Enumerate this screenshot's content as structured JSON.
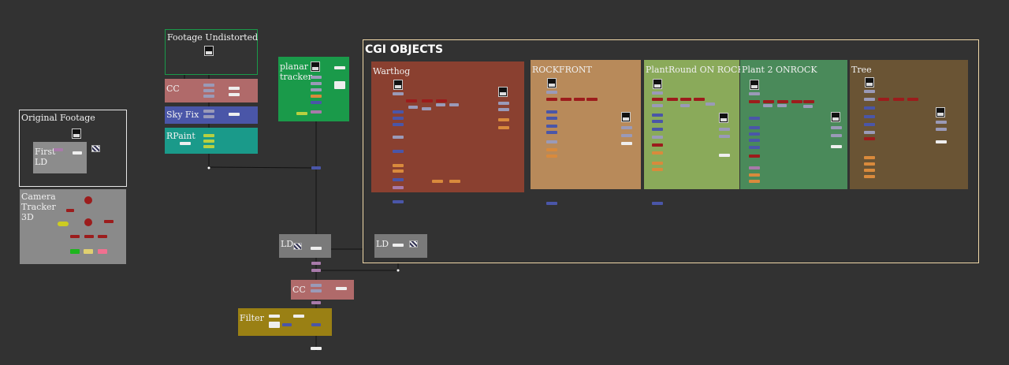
{
  "backdrops": {
    "original_footage": "Original Footage",
    "first_ld": "First\nLD",
    "camera_tracker": "Camera\nTracker\n3D",
    "footage_undistorted": "Footage Undistorted",
    "cc_top": "CC",
    "sky_fix": "Sky Fix",
    "rpaint": "RPaint",
    "planar_tracker": "planar\ntracker",
    "cgi_objects": "CGI OBJECTS",
    "warthog": "Warthog",
    "rockfront": "ROCKFRONT",
    "plantround": "PlantRound ON ROCK",
    "plant2": "Plant 2 ONROCK",
    "tree": "Tree",
    "ld_left": "LD",
    "ld_right": "LD",
    "cc_bottom": "CC",
    "filter": "Filter"
  },
  "colors": {
    "canvas": "#323232",
    "merge_node": "#4a56a8",
    "grade_node": "#9a9ab8",
    "transform_node": "#a87aaa",
    "blur_node": "#d98a3c",
    "read_node": "#eeeeee",
    "camera_node": "#9c1c1c"
  }
}
